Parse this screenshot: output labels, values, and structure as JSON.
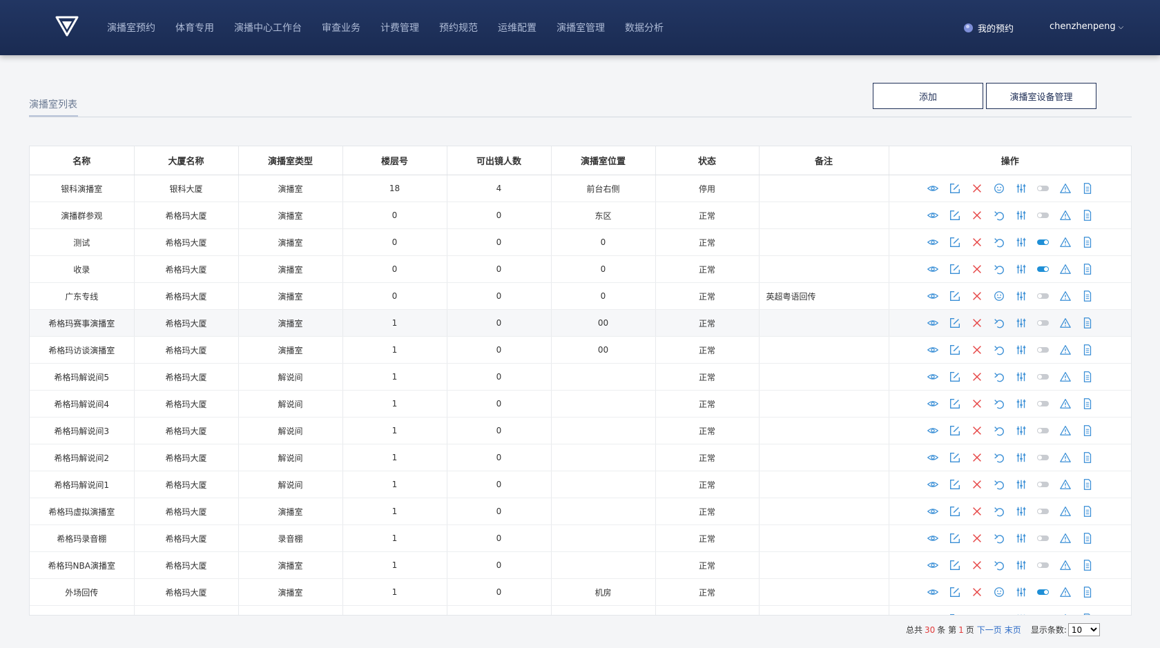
{
  "nav": {
    "items": [
      "演播室预约",
      "体育专用",
      "演播中心工作台",
      "审查业务",
      "计费管理",
      "预约规范",
      "运维配置",
      "演播室管理",
      "数据分析"
    ],
    "my_booking": "我的预约",
    "user": "chenzhenpeng"
  },
  "page": {
    "title": "演播室列表",
    "add_label": "添加",
    "device_label": "演播室设备管理"
  },
  "table": {
    "headers": [
      "名称",
      "大厦名称",
      "演播室类型",
      "楼层号",
      "可出镜人数",
      "演播室位置",
      "状态",
      "备注",
      "操作"
    ],
    "rows": [
      {
        "name": "银科演播室",
        "building": "银科大厦",
        "type": "演播室",
        "floor": "18",
        "cap": "4",
        "loc": "前台右侧",
        "status": "停用",
        "note": "",
        "reset": "smile",
        "on": false
      },
      {
        "name": "演播群参观",
        "building": "希格玛大厦",
        "type": "演播室",
        "floor": "0",
        "cap": "0",
        "loc": "东区",
        "status": "正常",
        "note": "",
        "reset": "undo",
        "on": false
      },
      {
        "name": "测试",
        "building": "希格玛大厦",
        "type": "演播室",
        "floor": "0",
        "cap": "0",
        "loc": "0",
        "status": "正常",
        "note": "",
        "reset": "undo",
        "on": true
      },
      {
        "name": "收录",
        "building": "希格玛大厦",
        "type": "演播室",
        "floor": "0",
        "cap": "0",
        "loc": "0",
        "status": "正常",
        "note": "",
        "reset": "undo",
        "on": true
      },
      {
        "name": "广东专线",
        "building": "希格玛大厦",
        "type": "演播室",
        "floor": "0",
        "cap": "0",
        "loc": "0",
        "status": "正常",
        "note": "英超粤语回传",
        "reset": "smile",
        "on": false
      },
      {
        "name": "希格玛赛事演播室",
        "building": "希格玛大厦",
        "type": "演播室",
        "floor": "1",
        "cap": "0",
        "loc": "00",
        "status": "正常",
        "note": "",
        "reset": "undo",
        "on": false
      },
      {
        "name": "希格玛访谈演播室",
        "building": "希格玛大厦",
        "type": "演播室",
        "floor": "1",
        "cap": "0",
        "loc": "00",
        "status": "正常",
        "note": "",
        "reset": "undo",
        "on": false
      },
      {
        "name": "希格玛解说间5",
        "building": "希格玛大厦",
        "type": "解说间",
        "floor": "1",
        "cap": "0",
        "loc": "",
        "status": "正常",
        "note": "",
        "reset": "undo",
        "on": false
      },
      {
        "name": "希格玛解说间4",
        "building": "希格玛大厦",
        "type": "解说间",
        "floor": "1",
        "cap": "0",
        "loc": "",
        "status": "正常",
        "note": "",
        "reset": "undo",
        "on": false
      },
      {
        "name": "希格玛解说间3",
        "building": "希格玛大厦",
        "type": "解说间",
        "floor": "1",
        "cap": "0",
        "loc": "",
        "status": "正常",
        "note": "",
        "reset": "undo",
        "on": false
      },
      {
        "name": "希格玛解说间2",
        "building": "希格玛大厦",
        "type": "解说间",
        "floor": "1",
        "cap": "0",
        "loc": "",
        "status": "正常",
        "note": "",
        "reset": "undo",
        "on": false
      },
      {
        "name": "希格玛解说间1",
        "building": "希格玛大厦",
        "type": "解说间",
        "floor": "1",
        "cap": "0",
        "loc": "",
        "status": "正常",
        "note": "",
        "reset": "undo",
        "on": false
      },
      {
        "name": "希格玛虚拟演播室",
        "building": "希格玛大厦",
        "type": "演播室",
        "floor": "1",
        "cap": "0",
        "loc": "",
        "status": "正常",
        "note": "",
        "reset": "undo",
        "on": false
      },
      {
        "name": "希格玛录音棚",
        "building": "希格玛大厦",
        "type": "录音棚",
        "floor": "1",
        "cap": "0",
        "loc": "",
        "status": "正常",
        "note": "",
        "reset": "undo",
        "on": false
      },
      {
        "name": "希格玛NBA演播室",
        "building": "希格玛大厦",
        "type": "演播室",
        "floor": "1",
        "cap": "0",
        "loc": "",
        "status": "正常",
        "note": "",
        "reset": "undo",
        "on": false
      },
      {
        "name": "外场回传",
        "building": "希格玛大厦",
        "type": "演播室",
        "floor": "1",
        "cap": "0",
        "loc": "机房",
        "status": "正常",
        "note": "",
        "reset": "smile",
        "on": true
      },
      {
        "name": "",
        "building": "",
        "type": "",
        "floor": "",
        "cap": "",
        "loc": "",
        "status": "",
        "note": "",
        "reset": "undo",
        "on": false
      }
    ]
  },
  "icons": {
    "view": "eye-icon",
    "edit": "edit-icon",
    "delete": "close-icon",
    "reset_undo": "undo-icon",
    "reset_smile": "smile-icon",
    "config": "sliders-icon",
    "toggle": "toggle-switch",
    "alert": "warning-icon",
    "doc": "document-icon"
  },
  "colors": {
    "nav_bg": "#1f3260",
    "icon_blue": "#3a8fd6",
    "icon_red": "#e64545",
    "toggle_on": "#1f8fd6"
  },
  "pager": {
    "total_prefix": "总共",
    "total": "30",
    "total_suffix": "条 第",
    "page": "1",
    "page_suffix": "页",
    "next": "下一页",
    "last": "末页",
    "size_label": "显示条数:",
    "size": "10"
  }
}
